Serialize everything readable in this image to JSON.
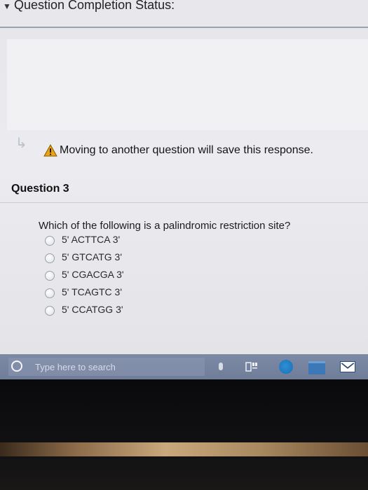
{
  "status_header": {
    "chevron_icon": "chevron-down-icon",
    "title": "Question Completion Status:"
  },
  "notice": {
    "arrow_icon": "return-arrow-icon",
    "warning_icon": "warning-icon",
    "message": "Moving to another question will save this response."
  },
  "question": {
    "title": "Question 3",
    "prompt": "Which of the following is a palindromic restriction site?",
    "options": [
      {
        "label": "5' ACTTCA 3'",
        "selected": false
      },
      {
        "label": "5' GTCATG 3'",
        "selected": false
      },
      {
        "label": "5' CGACGA 3'",
        "selected": false
      },
      {
        "label": "5' TCAGTC 3'",
        "selected": false
      },
      {
        "label": "5' CCATGG 3'",
        "selected": false
      }
    ]
  },
  "taskbar": {
    "search_placeholder": "Type here to search",
    "icons": [
      "cortana-icon",
      "microphone-icon",
      "task-view-icon",
      "edge-icon",
      "file-explorer-icon",
      "mail-icon"
    ]
  },
  "colors": {
    "taskbar": "#7584a0",
    "warning": "#e8a317",
    "rule": "#9aa3b0"
  }
}
